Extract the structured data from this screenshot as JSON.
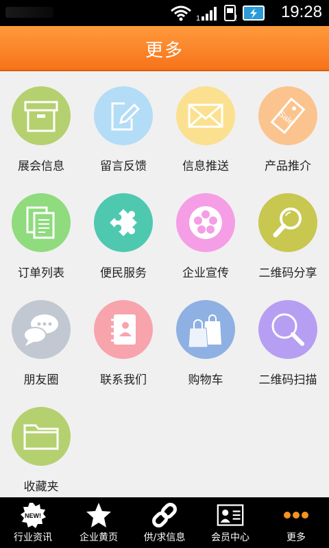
{
  "status": {
    "time": "19:28"
  },
  "header": {
    "title": "更多"
  },
  "grid": [
    {
      "label": "展会信息",
      "icon": "archive-box-icon",
      "color": "#b5d06f"
    },
    {
      "label": "留言反馈",
      "icon": "edit-note-icon",
      "color": "#b3dcf6"
    },
    {
      "label": "信息推送",
      "icon": "envelope-icon",
      "color": "#fbe08f"
    },
    {
      "label": "产品推介",
      "icon": "sale-tag-icon",
      "color": "#fbc48e"
    },
    {
      "label": "订单列表",
      "icon": "documents-icon",
      "color": "#8fdb7e"
    },
    {
      "label": "便民服务",
      "icon": "puzzle-icon",
      "color": "#4fc8b0"
    },
    {
      "label": "企业宣传",
      "icon": "film-reel-icon",
      "color": "#f59ee5"
    },
    {
      "label": "二维码分享",
      "icon": "magnifier-icon",
      "color": "#c8c74f"
    },
    {
      "label": "朋友圈",
      "icon": "chat-bubbles-icon",
      "color": "#c2c8d1"
    },
    {
      "label": "联系我们",
      "icon": "address-book-icon",
      "color": "#f7a4ad"
    },
    {
      "label": "购物车",
      "icon": "shopping-bags-icon",
      "color": "#8fb0e2"
    },
    {
      "label": "二维码扫描",
      "icon": "search-icon",
      "color": "#b69ff2"
    },
    {
      "label": "收藏夹",
      "icon": "folder-icon",
      "color": "#b5d06f"
    }
  ],
  "tabbar": [
    {
      "label": "行业资讯",
      "icon": "new-badge-icon"
    },
    {
      "label": "企业黄页",
      "icon": "star-icon"
    },
    {
      "label": "供/求信息",
      "icon": "chain-link-icon"
    },
    {
      "label": "会员中心",
      "icon": "id-card-icon"
    },
    {
      "label": "更多",
      "icon": "more-dots-icon"
    }
  ]
}
